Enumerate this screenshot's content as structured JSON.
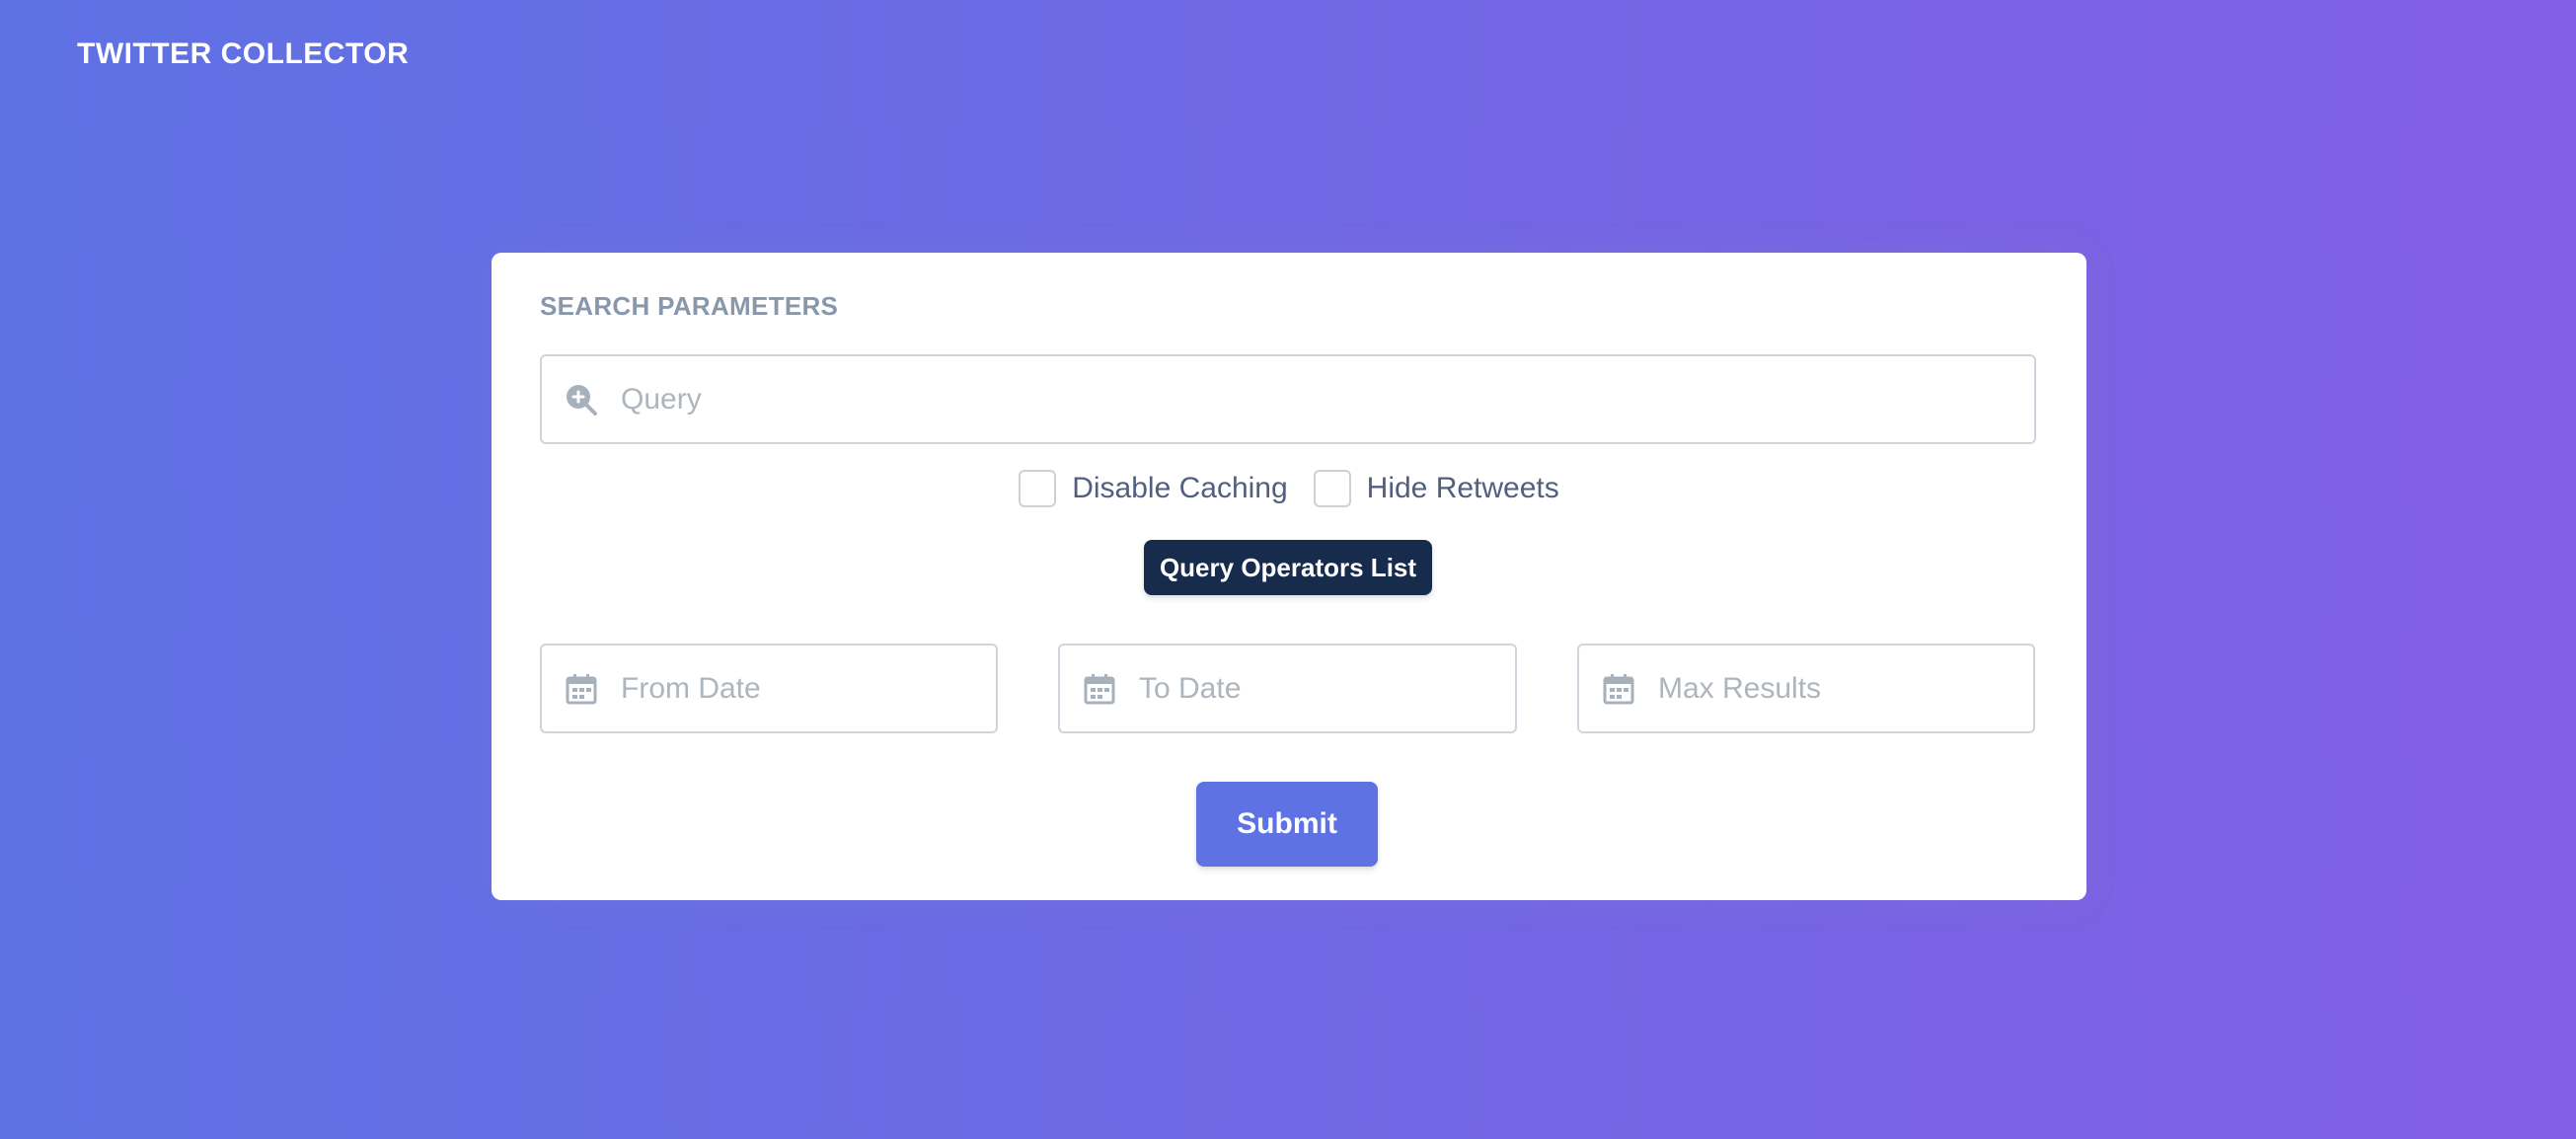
{
  "app": {
    "brand": "TWITTER COLLECTOR"
  },
  "colors": {
    "gradient_start": "#5e72e4",
    "gradient_end": "#825ee4",
    "primary": "#5e72e4",
    "dark": "#172b4d",
    "muted": "#8898aa"
  },
  "form": {
    "title": "SEARCH PARAMETERS",
    "query": {
      "value": "",
      "placeholder": "Query",
      "icon": "zoom-in-icon"
    },
    "checkboxes": [
      {
        "label": "Disable Caching",
        "checked": false
      },
      {
        "label": "Hide Retweets",
        "checked": false
      }
    ],
    "operators_button": "Query Operators List",
    "from_date": {
      "value": "",
      "placeholder": "From Date",
      "icon": "calendar-icon"
    },
    "to_date": {
      "value": "",
      "placeholder": "To Date",
      "icon": "calendar-icon"
    },
    "max_results": {
      "value": "",
      "placeholder": "Max Results",
      "icon": "calendar-icon"
    },
    "submit": "Submit"
  }
}
